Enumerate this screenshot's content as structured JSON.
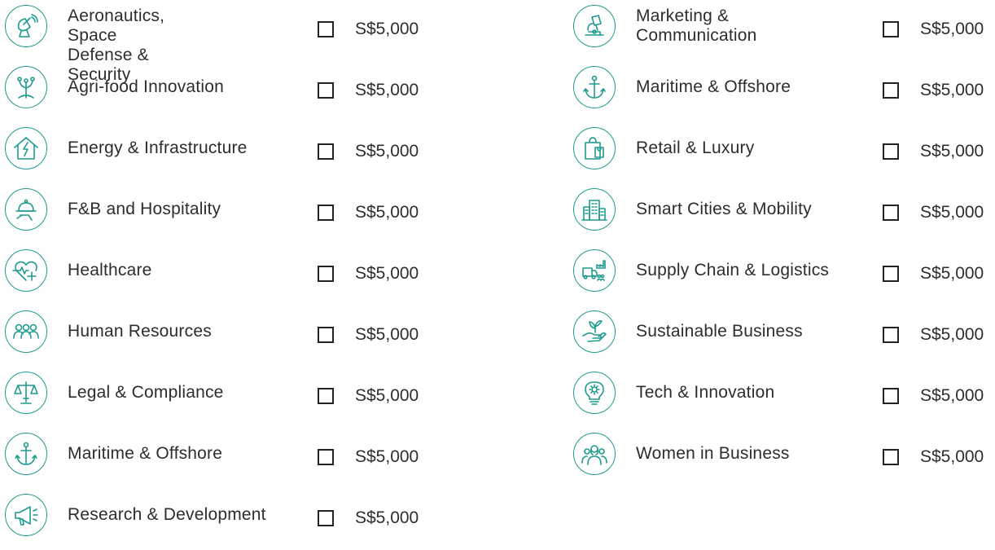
{
  "left_column": [
    {
      "label": "Aeronautics, Space\nDefense & Security",
      "price": "S$5,000",
      "icon": "satellite-dish-icon"
    },
    {
      "label": "Agri-food Innovation",
      "price": "S$5,000",
      "icon": "sprout-icon"
    },
    {
      "label": "Energy & Infrastructure",
      "price": "S$5,000",
      "icon": "house-lightning-icon"
    },
    {
      "label": "F&B and Hospitality",
      "price": "S$5,000",
      "icon": "cloche-icon"
    },
    {
      "label": "Healthcare",
      "price": "S$5,000",
      "icon": "heart-pulse-icon"
    },
    {
      "label": "Human Resources",
      "price": "S$5,000",
      "icon": "people-group-icon"
    },
    {
      "label": "Legal & Compliance",
      "price": "S$5,000",
      "icon": "scales-icon"
    },
    {
      "label": "Maritime & Offshore",
      "price": "S$5,000",
      "icon": "anchor-icon"
    },
    {
      "label": "Research & Development",
      "price": "S$5,000",
      "icon": "megaphone-icon"
    }
  ],
  "right_column": [
    {
      "label": "Marketing &\nCommunication",
      "price": "S$5,000",
      "icon": "microscope-icon"
    },
    {
      "label": "Maritime & Offshore",
      "price": "S$5,000",
      "icon": "anchor-icon"
    },
    {
      "label": "Retail & Luxury",
      "price": "S$5,000",
      "icon": "shopping-bag-icon"
    },
    {
      "label": "Smart Cities & Mobility",
      "price": "S$5,000",
      "icon": "city-building-icon"
    },
    {
      "label": "Supply Chain & Logistics",
      "price": "S$5,000",
      "icon": "truck-factory-icon"
    },
    {
      "label": "Sustainable Business",
      "price": "S$5,000",
      "icon": "hand-plant-icon"
    },
    {
      "label": "Tech & Innovation",
      "price": "S$5,000",
      "icon": "lightbulb-gear-icon"
    },
    {
      "label": "Women in Business",
      "price": "S$5,000",
      "icon": "women-group-icon"
    }
  ],
  "colors": {
    "icon_accent": "#1f9a8e",
    "text": "#2d2d2d",
    "checkbox_border": "#222222"
  }
}
